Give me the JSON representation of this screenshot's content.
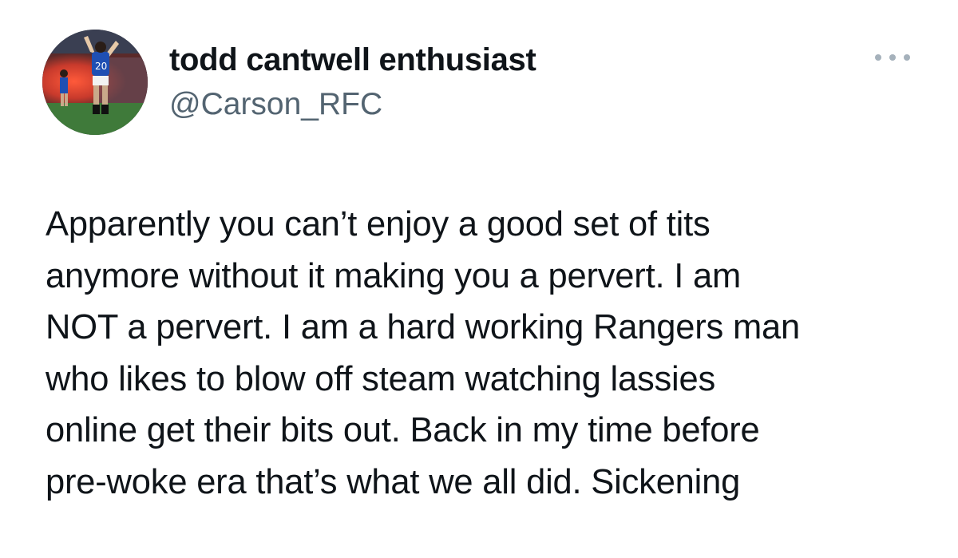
{
  "user": {
    "display_name": "todd cantwell enthusiast",
    "handle": "@Carson_RFC",
    "avatar_icon": "profile-photo-footballer-celebrating",
    "avatar_shirt_number": "20"
  },
  "menu": {
    "icon": "more-options-icon"
  },
  "tweet": {
    "lines": [
      "Apparently you can’t enjoy a good set of tits",
      "anymore without it making you a pervert. I am",
      "NOT a pervert. I am a hard working Rangers man",
      "who likes to blow off steam watching lassies",
      "online get their bits out. Back in my time before",
      "pre-woke era that’s what we all did. Sickening"
    ]
  },
  "colors": {
    "text_primary": "#0f1419",
    "text_secondary": "#536471",
    "menu_dots": "#a5b1bb",
    "background": "#ffffff"
  }
}
